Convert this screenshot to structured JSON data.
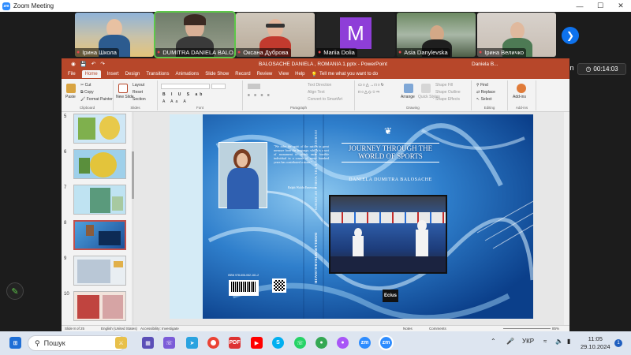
{
  "zoom": {
    "title": "Zoom Meeting",
    "sign_in": "Sign in",
    "timer": "00:14:03",
    "participants": [
      {
        "name": "Ірина Школа"
      },
      {
        "name": "DUMITRA DANIELA BALO..."
      },
      {
        "name": "Оксана Дуброва"
      },
      {
        "name": "Mariia Dolia",
        "initial": "M"
      },
      {
        "name": "Asia Danylevska"
      },
      {
        "name": "Ірина Величко"
      }
    ]
  },
  "powerpoint": {
    "document_title": "BALOSACHE DANIELA , ROMANIA 1.pptx - PowerPoint",
    "user": "Daniela B...",
    "tabs": [
      "File",
      "Home",
      "Insert",
      "Design",
      "Transitions",
      "Animations",
      "Slide Show",
      "Record",
      "Review",
      "View",
      "Help"
    ],
    "active_tab": "Home",
    "tell_me": "Tell me what you want to do",
    "ribbon": {
      "clipboard": {
        "paste": "Paste",
        "cut": "Cut",
        "copy": "Copy",
        "format_painter": "Format Painter",
        "group": "Clipboard"
      },
      "slides": {
        "new_slide": "New Slide",
        "layout": "Layout",
        "reset": "Reset",
        "section": "Section",
        "group": "Slides"
      },
      "font_group": "Font",
      "paragraph": {
        "text_direction": "Text Direction",
        "align_text": "Align Text",
        "convert_smartart": "Convert to SmartArt",
        "group": "Paragraph"
      },
      "drawing": {
        "arrange": "Arrange",
        "quick_styles": "Quick Styles",
        "shape_fill": "Shape Fill",
        "shape_outline": "Shape Outline",
        "shape_effects": "Shape Effects",
        "group": "Drawing"
      },
      "editing": {
        "find": "Find",
        "replace": "Replace",
        "select": "Select",
        "group": "Editing"
      },
      "addins": {
        "label": "Add-ins",
        "group": "Add-ins"
      }
    },
    "thumbnails": [
      {
        "num": "5"
      },
      {
        "num": "6"
      },
      {
        "num": "7"
      },
      {
        "num": "8",
        "selected": true
      },
      {
        "num": "9"
      },
      {
        "num": "10"
      }
    ],
    "slide": {
      "book_title": "JOURNEY THROUGH THE WORLD OF SPORTS",
      "author": "DANIELA DUMITRA BALOSACHE",
      "spine": "JOURNEY THROUGH THE WORLD OF SPORTS",
      "spine_author": "DANIELA DUMITRA BALOSACHE",
      "quote": "\"We infer the spirit of the nation in great measure from the language, which is a sort of monument to which each forcible individual in a course of many hundred years has contributed a stone.\"",
      "quote_author": "Ralph Waldo Emerson",
      "isbn": "ISBN 978-606-062-161-2",
      "publisher": "Ecius"
    },
    "status": {
      "slide_of": "Slide 8 of 25",
      "language": "English (United States)",
      "accessibility": "Accessibility: Investigate",
      "notes": "Notes",
      "comments": "Comments",
      "zoom": "85%"
    }
  },
  "taskbar": {
    "search": "Пошук",
    "language": "УКР",
    "time": "11:05",
    "date": "29.10.2024",
    "notifications": "1"
  }
}
